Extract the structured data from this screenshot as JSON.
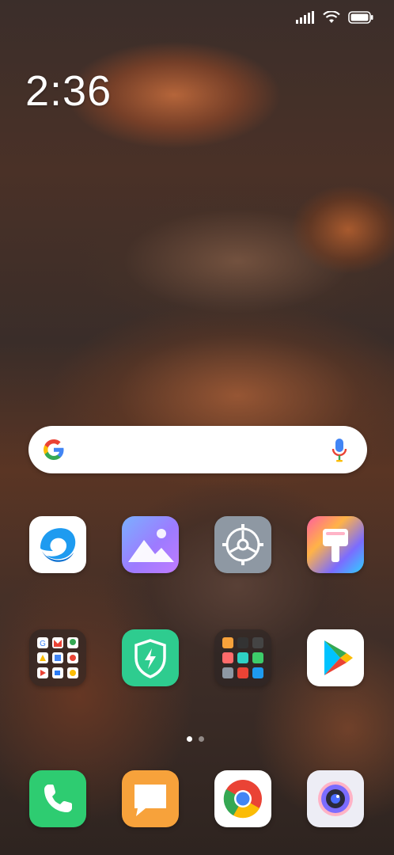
{
  "status_bar": {
    "time": "2:36",
    "icons": [
      "signal-icon",
      "wifi-icon",
      "battery-icon"
    ]
  },
  "search": {
    "provider_icon": "google-g-icon",
    "voice_icon": "microphone-icon"
  },
  "home_screen": {
    "row1": [
      "browser-app-icon",
      "gallery-app-icon",
      "settings-app-icon",
      "themes-app-icon"
    ],
    "row2": [
      "google-apps-folder",
      "security-app-icon",
      "tools-folder",
      "play-store-app-icon"
    ],
    "page_indicator": {
      "pages": 2,
      "active": 1
    }
  },
  "dock": [
    "phone-app-icon",
    "messages-app-icon",
    "chrome-app-icon",
    "camera-app-icon"
  ],
  "colors": {
    "phone": "#2ECC71",
    "messages": "#F7A23B",
    "security": "#2ECC8F",
    "settings": "#8E98A3",
    "browser": "#1E9BF0"
  }
}
